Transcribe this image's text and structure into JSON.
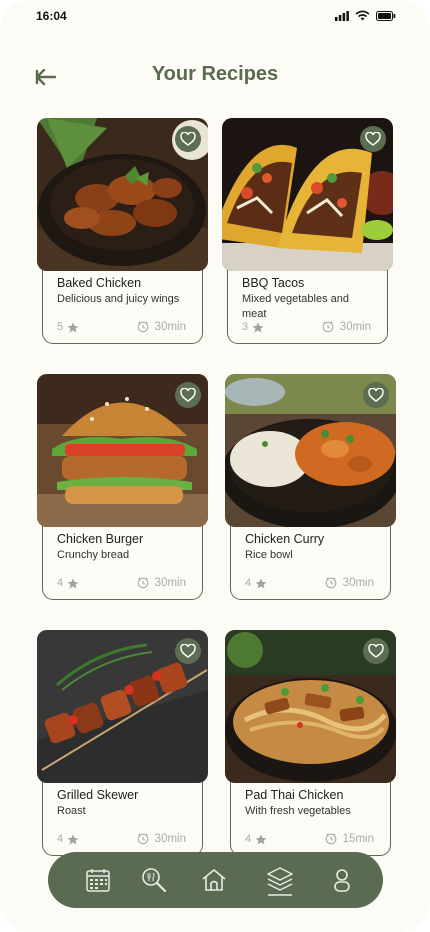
{
  "status_bar": {
    "time": "16:04"
  },
  "header": {
    "title": "Your Recipes"
  },
  "recipes": [
    {
      "name": "Baked Chicken",
      "desc": "Delicious and juicy wings",
      "rating": "5",
      "duration": "30min"
    },
    {
      "name": "BBQ Tacos",
      "desc": "Mixed vegetables and meat",
      "rating": "3",
      "duration": "30min"
    },
    {
      "name": "Chicken Burger",
      "desc": "Crunchy bread",
      "rating": "4",
      "duration": "30min"
    },
    {
      "name": "Chicken Curry",
      "desc": "Rice bowl",
      "rating": "4",
      "duration": "30min"
    },
    {
      "name": "Grilled Skewer",
      "desc": "Roast",
      "rating": "4",
      "duration": "30min"
    },
    {
      "name": "Pad Thai Chicken",
      "desc": "With fresh vegetables",
      "rating": "4",
      "duration": "15min"
    }
  ],
  "nav": {
    "items": [
      "calendar-icon",
      "search-food-icon",
      "home-icon",
      "recipes-icon",
      "profile-icon"
    ],
    "active": "recipes-icon"
  },
  "colors": {
    "accent": "#5b6b52",
    "title": "#5a6b4f",
    "background": "#fcfbf6"
  }
}
